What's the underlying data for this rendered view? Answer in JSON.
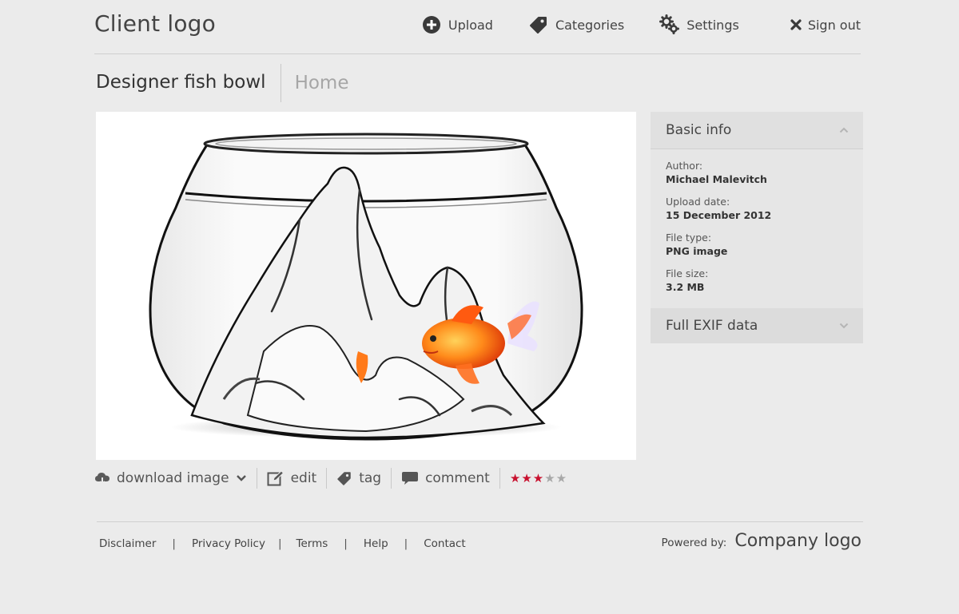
{
  "header": {
    "logo": "Client logo",
    "nav": [
      {
        "label": "Upload",
        "icon": "plus-circle-icon"
      },
      {
        "label": "Categories",
        "icon": "tag-icon"
      },
      {
        "label": "Settings",
        "icon": "gears-icon"
      },
      {
        "label": "Sign out",
        "icon": "close-x-icon"
      }
    ]
  },
  "title": {
    "page_title": "Designer fish bowl",
    "breadcrumb": "Home"
  },
  "image": {
    "alt": "Designer fish bowl"
  },
  "actions": {
    "download": "download image",
    "edit": "edit",
    "tag": "tag",
    "comment": "comment",
    "rating": 3,
    "rating_max": 5,
    "rating_color": "#c8102e",
    "rating_empty_color": "#a8a8a8"
  },
  "sidebar": {
    "basic_info": {
      "title": "Basic info",
      "expanded": true,
      "fields": [
        {
          "label": "Author:",
          "value": "Michael Malevitch"
        },
        {
          "label": "Upload date:",
          "value": "15 December 2012"
        },
        {
          "label": "File type:",
          "value": "PNG image"
        },
        {
          "label": "File size:",
          "value": "3.2 MB"
        }
      ]
    },
    "exif": {
      "title": "Full EXIF data",
      "expanded": false
    }
  },
  "footer": {
    "links": [
      "Disclaimer",
      "Privacy Policy",
      "Terms",
      "Help",
      "Contact"
    ],
    "separator": "|",
    "powered_label": "Powered by:",
    "company_logo": "Company logo"
  }
}
